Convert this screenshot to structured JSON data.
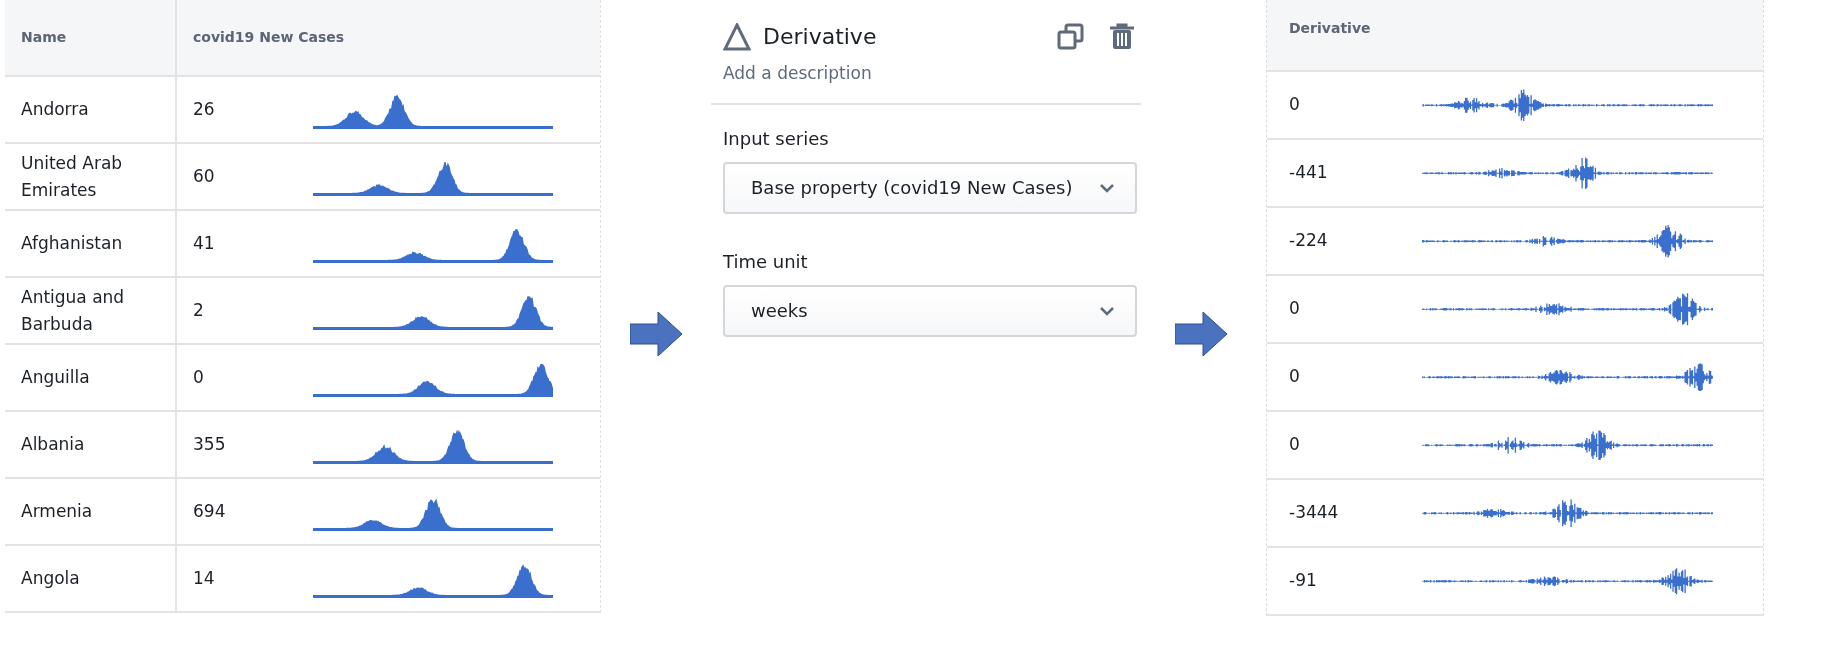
{
  "input_table": {
    "columns": [
      "Name",
      "covid19 New Cases"
    ],
    "rows": [
      {
        "name": "Andorra",
        "value": "26"
      },
      {
        "name": "United Arab Emirates",
        "value": "60"
      },
      {
        "name": "Afghanistan",
        "value": "41"
      },
      {
        "name": "Antigua and Barbuda",
        "value": "2"
      },
      {
        "name": "Anguilla",
        "value": "0"
      },
      {
        "name": "Albania",
        "value": "355"
      },
      {
        "name": "Armenia",
        "value": "694"
      },
      {
        "name": "Angola",
        "value": "14"
      }
    ]
  },
  "transform": {
    "title": "Derivative",
    "description": "Add a description",
    "fields": [
      {
        "label": "Input series",
        "value": "Base property (covid19 New Cases)"
      },
      {
        "label": "Time unit",
        "value": "weeks"
      }
    ]
  },
  "output_table": {
    "columns": [
      "Derivative"
    ],
    "rows": [
      {
        "value": "0"
      },
      {
        "value": "-441"
      },
      {
        "value": "-224"
      },
      {
        "value": "0"
      },
      {
        "value": "0"
      },
      {
        "value": "0"
      },
      {
        "value": "-3444"
      },
      {
        "value": "-91"
      }
    ]
  }
}
